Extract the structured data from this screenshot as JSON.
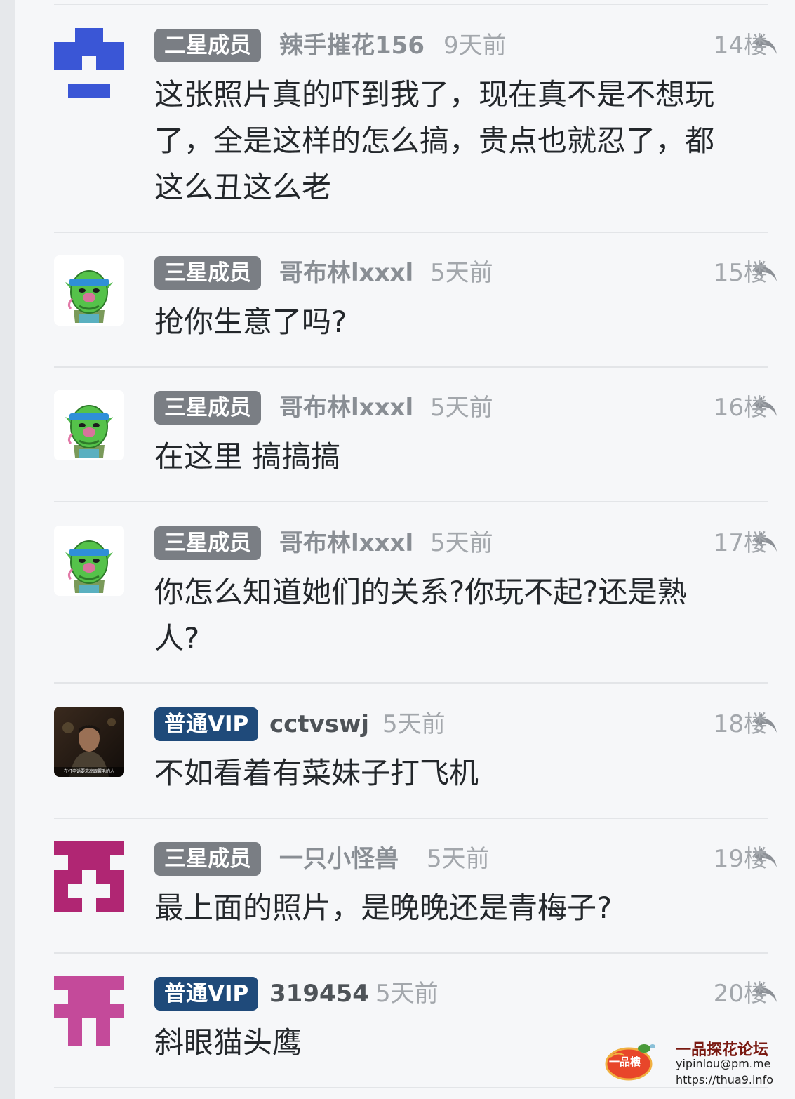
{
  "posts": [
    {
      "badge": "二星成员",
      "user": "辣手摧花156",
      "time": "9天前",
      "floor": "14楼",
      "lines": [
        "这张照片真的吓到我了，现在真不是不想玩",
        "了，全是这样的怎么搞，贵点也就忍了，都",
        "这么丑这么老"
      ]
    },
    {
      "badge": "三星成员",
      "user": "哥布林lxxxl",
      "time": "5天前",
      "floor": "15楼",
      "lines": [
        "抢你生意了吗?"
      ]
    },
    {
      "badge": "三星成员",
      "user": "哥布林lxxxl",
      "time": "5天前",
      "floor": "16楼",
      "lines": [
        "在这里 搞搞搞"
      ]
    },
    {
      "badge": "三星成员",
      "user": "哥布林lxxxl",
      "time": "5天前",
      "floor": "17楼",
      "lines": [
        "你怎么知道她们的关系?你玩不起?还是熟",
        "人?"
      ]
    },
    {
      "badge": "普通VIP",
      "user": "cctvswj",
      "time": "5天前",
      "floor": "18楼",
      "lines": [
        "不如看着有菜妹子打飞机"
      ],
      "avatar_caption": "在打电话要求高跟翼毛的人"
    },
    {
      "badge": "三星成员",
      "user": "一只小怪兽",
      "time": "5天前",
      "floor": "19楼",
      "lines": [
        "最上面的照片，是晚晚还是青梅子?"
      ]
    },
    {
      "badge": "普通VIP",
      "user": "319454",
      "time": "5天前",
      "floor": "20楼",
      "lines": [
        "斜眼猫头鹰"
      ]
    }
  ],
  "watermark": {
    "title": "一品探花论坛",
    "email": "yipinlou@pm.me",
    "url": "https://thua9.info",
    "logo_text": "一品樓"
  },
  "colors": {
    "badge_gray": "#7a7e84",
    "badge_vip": "#1f4a7a",
    "identicon_blue": "#3a56d6",
    "identicon_magenta": "#b02673",
    "identicon_pink": "#c44a9a"
  }
}
